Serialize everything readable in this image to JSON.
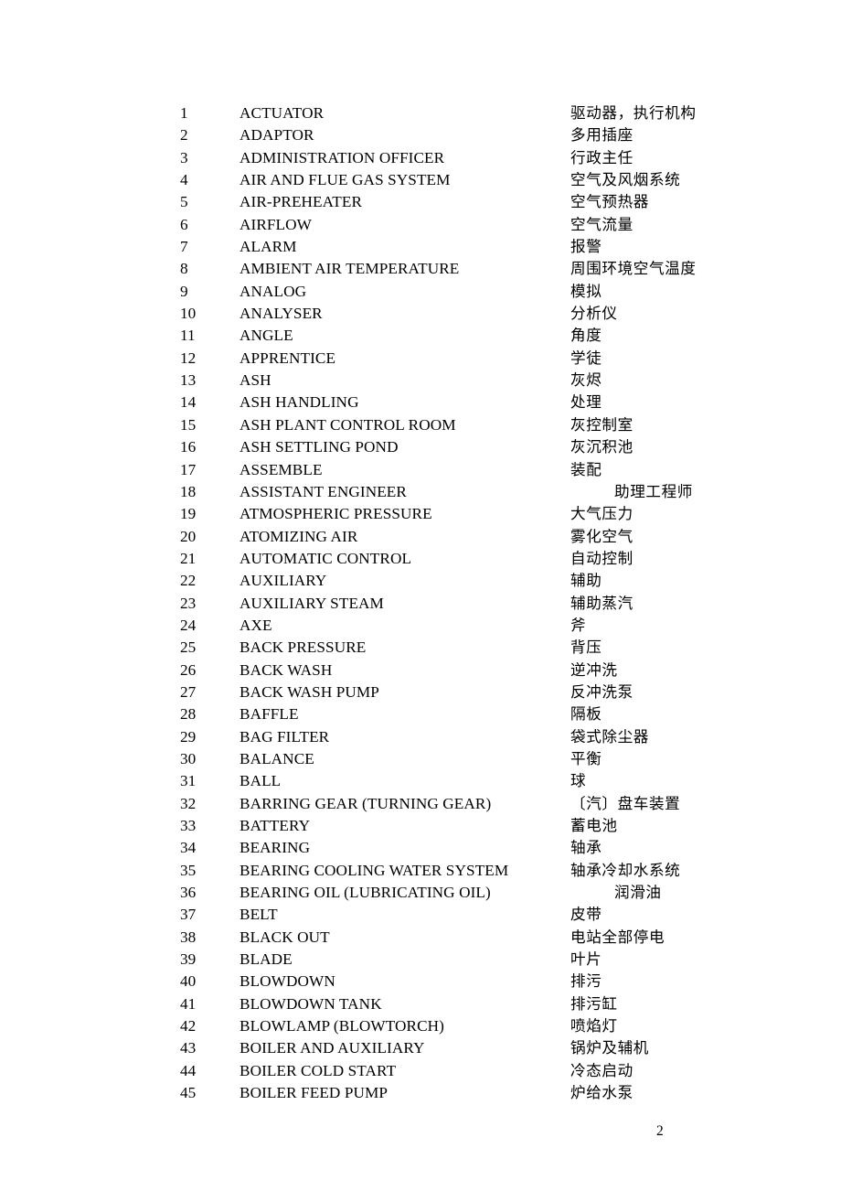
{
  "document": {
    "page_number": "2",
    "columns": {
      "index_header": "",
      "term_header": "",
      "gloss_header": ""
    },
    "entries": [
      {
        "index": "1",
        "term": "ACTUATOR",
        "gloss": "驱动器，执行机构",
        "indent": 0
      },
      {
        "index": "2",
        "term": "ADAPTOR",
        "gloss": "多用插座",
        "indent": 0
      },
      {
        "index": "3",
        "term": "ADMINISTRATION OFFICER",
        "gloss": "行政主任",
        "indent": 0
      },
      {
        "index": "4",
        "term": "AIR AND FLUE GAS SYSTEM",
        "gloss": "空气及风烟系统",
        "indent": 0
      },
      {
        "index": "5",
        "term": "AIR-PREHEATER",
        "gloss": "空气预热器",
        "indent": 0
      },
      {
        "index": "6",
        "term": "AIRFLOW",
        "gloss": "空气流量",
        "indent": 0
      },
      {
        "index": "7",
        "term": "ALARM",
        "gloss": "报警",
        "indent": 0
      },
      {
        "index": "8",
        "term": "AMBIENT AIR TEMPERATURE",
        "gloss": "周围环境空气温度",
        "indent": 0
      },
      {
        "index": "9",
        "term": "ANALOG",
        "gloss": "模拟",
        "indent": 0
      },
      {
        "index": "10",
        "term": "ANALYSER",
        "gloss": "分析仪",
        "indent": 0
      },
      {
        "index": "11",
        "term": "ANGLE",
        "gloss": "角度",
        "indent": 0
      },
      {
        "index": "12",
        "term": "APPRENTICE",
        "gloss": "学徒",
        "indent": 0
      },
      {
        "index": "13",
        "term": "ASH",
        "gloss": "灰烬",
        "indent": 0
      },
      {
        "index": "14",
        "term": "ASH HANDLING",
        "gloss": "处理",
        "indent": 0
      },
      {
        "index": "15",
        "term": "ASH PLANT CONTROL ROOM",
        "gloss": "灰控制室",
        "indent": 0
      },
      {
        "index": "16",
        "term": "ASH SETTLING POND",
        "gloss": "灰沉积池",
        "indent": 0
      },
      {
        "index": "17",
        "term": "ASSEMBLE",
        "gloss": "装配",
        "indent": 0
      },
      {
        "index": "18",
        "term": "ASSISTANT ENGINEER",
        "gloss": "助理工程师",
        "indent": 2
      },
      {
        "index": "19",
        "term": "ATMOSPHERIC PRESSURE",
        "gloss": "大气压力",
        "indent": 0
      },
      {
        "index": "20",
        "term": "ATOMIZING AIR",
        "gloss": "雾化空气",
        "indent": 0
      },
      {
        "index": "21",
        "term": "AUTOMATIC CONTROL",
        "gloss": "自动控制",
        "indent": 0
      },
      {
        "index": "22",
        "term": "AUXILIARY",
        "gloss": "辅助",
        "indent": 0
      },
      {
        "index": "23",
        "term": "AUXILIARY STEAM",
        "gloss": "辅助蒸汽",
        "indent": 0
      },
      {
        "index": "24",
        "term": "AXE",
        "gloss": "斧",
        "indent": 0
      },
      {
        "index": "25",
        "term": "BACK PRESSURE",
        "gloss": "背压",
        "indent": 0
      },
      {
        "index": "26",
        "term": "BACK WASH",
        "gloss": "逆冲洗",
        "indent": 0
      },
      {
        "index": "27",
        "term": "BACK WASH PUMP",
        "gloss": "反冲洗泵",
        "indent": 0
      },
      {
        "index": "28",
        "term": "BAFFLE",
        "gloss": "隔板",
        "indent": 0
      },
      {
        "index": "29",
        "term": "BAG FILTER",
        "gloss": "袋式除尘器",
        "indent": 0
      },
      {
        "index": "30",
        "term": "BALANCE",
        "gloss": "平衡",
        "indent": 0
      },
      {
        "index": "31",
        "term": "BALL",
        "gloss": "球",
        "indent": 0
      },
      {
        "index": "32",
        "term": "BARRING GEAR (TURNING GEAR)",
        "gloss": "〔汽〕盘车装置",
        "indent": 0
      },
      {
        "index": "33",
        "term": "BATTERY",
        "gloss": "蓄电池",
        "indent": 0
      },
      {
        "index": "34",
        "term": "BEARING",
        "gloss": "轴承",
        "indent": 0
      },
      {
        "index": "35",
        "term": "BEARING COOLING WATER SYSTEM",
        "gloss": "轴承冷却水系统",
        "indent": 0
      },
      {
        "index": "36",
        "term": "BEARING OIL (LUBRICATING OIL)",
        "gloss": "润滑油",
        "indent": 2
      },
      {
        "index": "37",
        "term": "BELT",
        "gloss": "皮带",
        "indent": 0
      },
      {
        "index": "38",
        "term": "BLACK OUT",
        "gloss": "电站全部停电",
        "indent": 0
      },
      {
        "index": "39",
        "term": "BLADE",
        "gloss": "叶片",
        "indent": 0
      },
      {
        "index": "40",
        "term": "BLOWDOWN",
        "gloss": "排污",
        "indent": 0
      },
      {
        "index": "41",
        "term": "BLOWDOWN TANK",
        "gloss": "排污缸",
        "indent": 0
      },
      {
        "index": "42",
        "term": "BLOWLAMP (BLOWTORCH)",
        "gloss": "喷焰灯",
        "indent": 0
      },
      {
        "index": "43",
        "term": "BOILER AND AUXILIARY",
        "gloss": "锅炉及辅机",
        "indent": 0
      },
      {
        "index": "44",
        "term": "BOILER COLD START",
        "gloss": "冷态启动",
        "indent": 0
      },
      {
        "index": "45",
        "term": "BOILER FEED PUMP",
        "gloss": "炉给水泵",
        "indent": 0
      }
    ]
  }
}
